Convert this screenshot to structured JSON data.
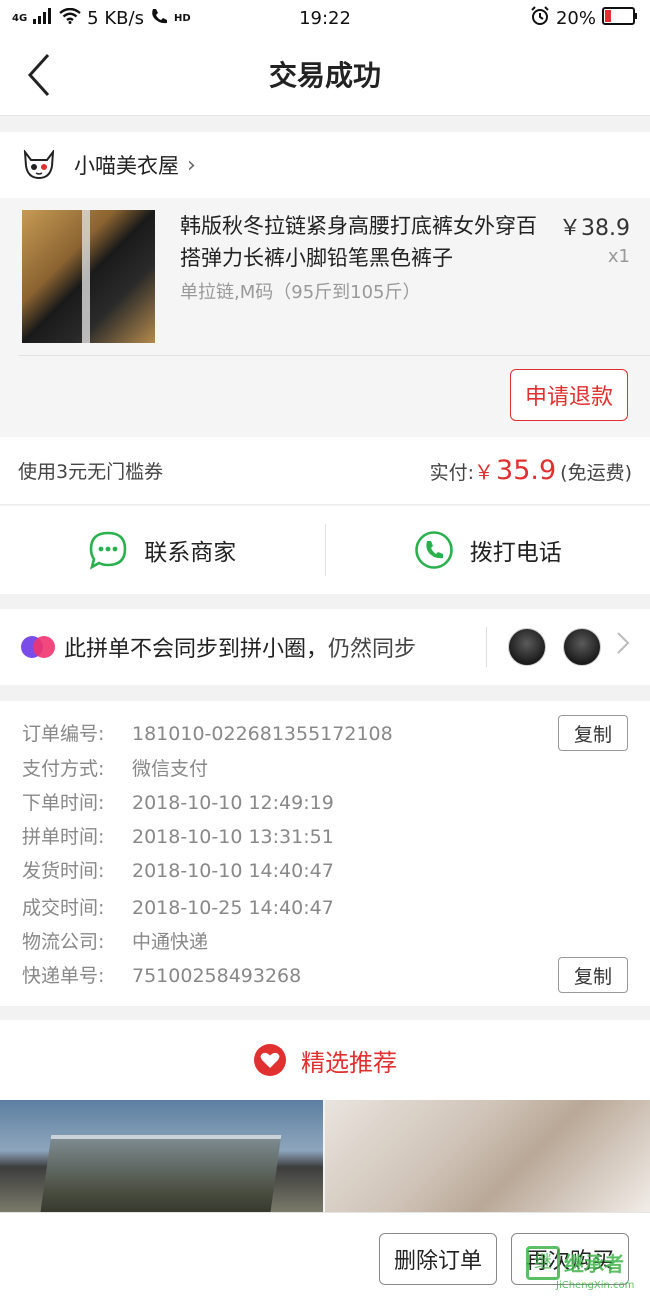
{
  "status_bar": {
    "network": "4G",
    "speed": "5 KB/s",
    "hd": "HD",
    "time": "19:22",
    "battery": "20%",
    "colors": {
      "battery_low": "#e0302f"
    }
  },
  "nav": {
    "title": "交易成功"
  },
  "shop": {
    "name": "小喵美衣屋",
    "chevron": "›"
  },
  "product": {
    "title": "韩版秋冬拉链紧身高腰打底裤女外穿百搭弹力长裤小脚铅笔黑色裤子",
    "spec": "单拉链,M码（95斤到105斤）",
    "price": "￥38.9",
    "qty": "x1",
    "refund_label": "申请退款"
  },
  "payment": {
    "coupon": "使用3元无门槛券",
    "paid_label": "实付:",
    "currency": "￥",
    "amount": "35.9",
    "shipping_note": "(免运费)"
  },
  "contact": {
    "merchant_label": "联系商家",
    "call_label": "拨打电话"
  },
  "sync": {
    "text_main": "此拼单不会同步到拼小圈，",
    "text_action": "仍然同步"
  },
  "order_info": {
    "rows": [
      {
        "label": "订单编号:",
        "value": "181010-022681355172108"
      },
      {
        "label": "支付方式:",
        "value": "微信支付"
      },
      {
        "label": "下单时间:",
        "value": "2018-10-10 12:49:19"
      },
      {
        "label": "拼单时间:",
        "value": "2018-10-10 13:31:51"
      },
      {
        "label": "发货时间:",
        "value": "2018-10-10 14:40:47"
      },
      {
        "label": "成交时间:",
        "value": "2018-10-25 14:40:47"
      },
      {
        "label": "物流公司:",
        "value": "中通快递"
      },
      {
        "label": "快递单号:",
        "value": "75100258493268"
      }
    ],
    "copy_label": "复制"
  },
  "recommend": {
    "title": "精选推荐"
  },
  "bottom": {
    "delete_label": "删除订单",
    "rebuy_label": "再次购买"
  },
  "watermark": {
    "title": "继承者",
    "sub": "JiChengXin.com"
  },
  "colors": {
    "accent": "#e0302f",
    "wechat_green": "#2ab14e"
  }
}
